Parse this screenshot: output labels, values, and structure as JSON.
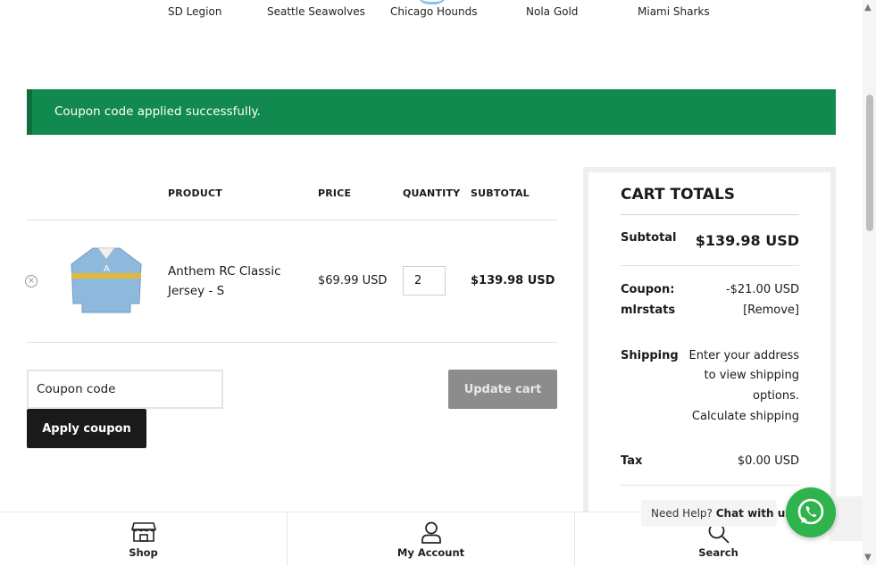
{
  "teams": [
    "SD Legion",
    "Seattle Seawolves",
    "Chicago Hounds",
    "Nola Gold",
    "Miami Sharks"
  ],
  "notice": {
    "message": "Coupon code applied successfully."
  },
  "cart_table": {
    "headers": {
      "product": "PRODUCT",
      "price": "PRICE",
      "quantity": "QUANTITY",
      "subtotal": "SUBTOTAL"
    },
    "items": [
      {
        "name": "Anthem RC Classic Jersey - S",
        "price": "$69.99 USD",
        "quantity": "2",
        "subtotal": "$139.98 USD"
      }
    ]
  },
  "coupon": {
    "placeholder": "Coupon code",
    "apply_label": "Apply coupon"
  },
  "update_label": "Update cart",
  "totals": {
    "title": "CART TOTALS",
    "subtotal_label": "Subtotal",
    "subtotal_value": "$139.98 USD",
    "coupon_label_1": "Coupon:",
    "coupon_label_2": "mlrstats",
    "coupon_value": "-$21.00 USD",
    "coupon_remove": "[Remove]",
    "shipping_label": "Shipping",
    "shipping_line1": "Enter your address",
    "shipping_line2": "to view shipping",
    "shipping_line3": "options.",
    "calculate_shipping": "Calculate shipping",
    "tax_label": "Tax",
    "tax_value": "$0.00 USD"
  },
  "bottom_nav": {
    "shop": "Shop",
    "account": "My Account",
    "search": "Search"
  },
  "help": {
    "prefix": "Need Help?",
    "cta": "Chat with us"
  },
  "colors": {
    "notice_green": "#128a4f",
    "whatsapp_green": "#2fb34c",
    "dark_button": "#1a1a1a",
    "muted_button": "#8c8c8c"
  },
  "icons": [
    "close-circle-icon",
    "store-icon",
    "user-icon",
    "search-icon",
    "whatsapp-icon"
  ]
}
